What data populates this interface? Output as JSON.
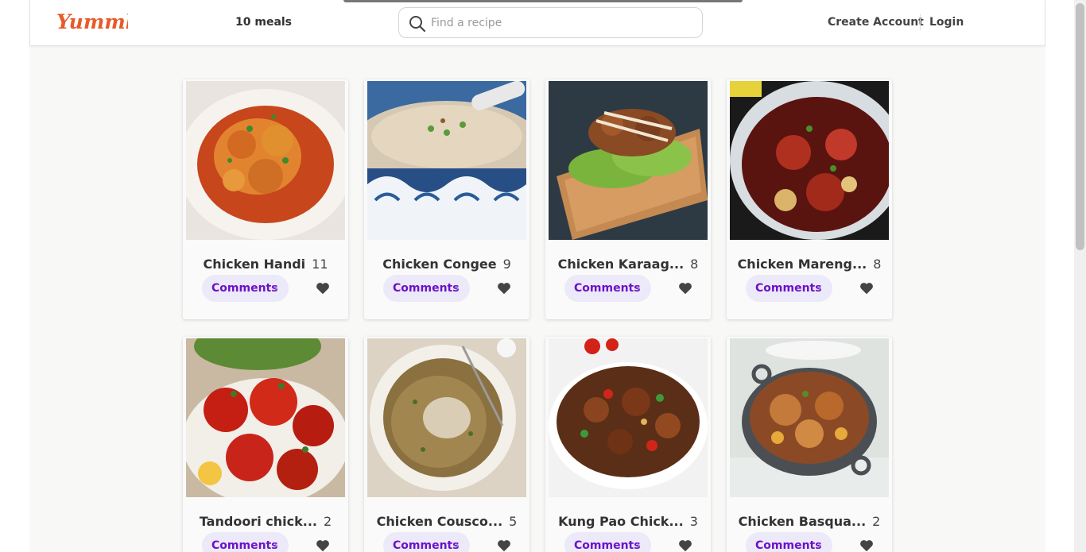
{
  "header": {
    "logo_text": "Yummly",
    "meals_count": "10 meals",
    "search_placeholder": "Find a recipe",
    "search_value": "",
    "create_account": "Create Account",
    "login": "Login"
  },
  "colors": {
    "logo": "#e85a29",
    "comments_text": "#6d12c9",
    "comments_bg": "#ece9f8",
    "heart": "#444444"
  },
  "cards": [
    {
      "title": "Chicken Handi",
      "count": "11",
      "comments": "Comments"
    },
    {
      "title": "Chicken Congee",
      "count": "9",
      "comments": "Comments"
    },
    {
      "title": "Chicken Karaag...",
      "count": "8",
      "comments": "Comments"
    },
    {
      "title": "Chicken Mareng...",
      "count": "8",
      "comments": "Comments"
    },
    {
      "title": "Tandoori chick...",
      "count": "2",
      "comments": "Comments"
    },
    {
      "title": "Chicken Cousco...",
      "count": "5",
      "comments": "Comments"
    },
    {
      "title": "Kung Pao Chick...",
      "count": "3",
      "comments": "Comments"
    },
    {
      "title": "Chicken Basqua...",
      "count": "2",
      "comments": "Comments"
    }
  ]
}
